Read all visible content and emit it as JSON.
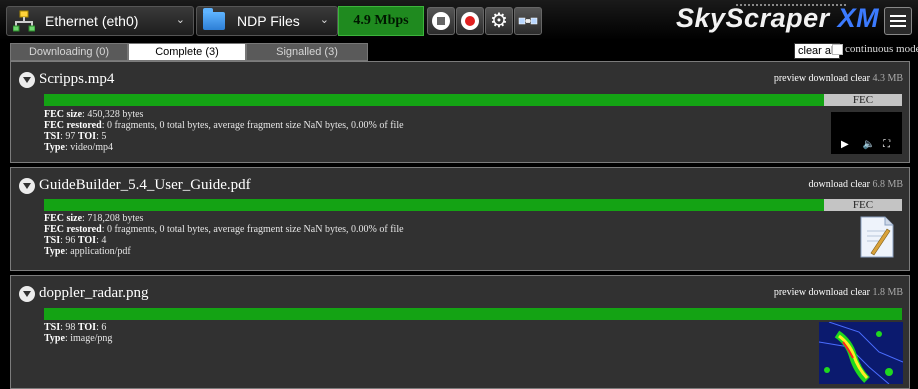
{
  "toolbar": {
    "interface_label": "Ethernet (eth0)",
    "ndp_label": "NDP Files",
    "rate": "4.9 Mbps",
    "logo_main": "SkyScraper",
    "logo_accent": "XM",
    "rate_color": "#1f8a1f"
  },
  "tabs": [
    {
      "label": "Downloading (0)",
      "active": false
    },
    {
      "label": "Complete (3)",
      "active": true
    },
    {
      "label": "Signalled (3)",
      "active": false
    }
  ],
  "controls": {
    "clear_all": "clear all",
    "continuous_mode": "continuous mode"
  },
  "files": [
    {
      "name": "Scripps.mp4",
      "preview": "preview",
      "download": "download",
      "clear": "clear",
      "size": "4.3 MB",
      "progress": 0.93,
      "fec_label": "FEC",
      "fec_size": "450,328 bytes",
      "fec_restored": "0 fragments, 0 total bytes, average fragment size NaN bytes, 0.00% of file",
      "tsi": "97",
      "toi": "5",
      "type": "video/mp4"
    },
    {
      "name": "GuideBuilder_5.4_User_Guide.pdf",
      "download": "download",
      "clear": "clear",
      "size": "6.8 MB",
      "progress": 0.93,
      "fec_label": "FEC",
      "fec_size": "718,208 bytes",
      "fec_restored": "0 fragments, 0 total bytes, average fragment size NaN bytes, 0.00% of file",
      "tsi": "96",
      "toi": "4",
      "type": "application/pdf"
    },
    {
      "name": "doppler_radar.png",
      "preview": "preview",
      "download": "download",
      "clear": "clear",
      "size": "1.8 MB",
      "progress": 1.0,
      "tsi": "98",
      "toi": "6",
      "type": "image/png"
    }
  ],
  "labels": {
    "fec_size": "FEC size",
    "fec_restored": "FEC restored",
    "tsi": "TSI",
    "toi": "TOI",
    "type": "Type"
  }
}
